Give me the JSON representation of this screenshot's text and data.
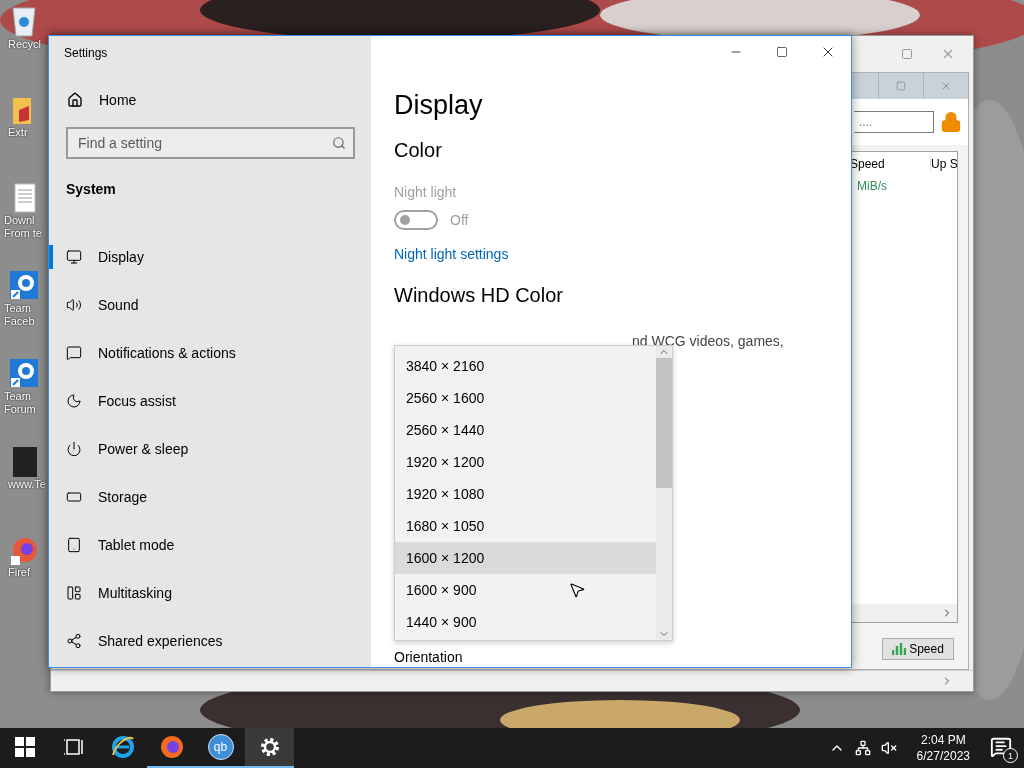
{
  "desktop": {
    "icons": [
      {
        "kind": "recycle",
        "label": "Recycl"
      },
      {
        "kind": "folder",
        "label": "Extr"
      },
      {
        "kind": "document",
        "label": "Downl\nFrom te"
      },
      {
        "kind": "gear",
        "label": "Team\nFaceb"
      },
      {
        "kind": "gear",
        "label": "Team\nForum"
      },
      {
        "kind": "dark",
        "label": "www.Te"
      },
      {
        "kind": "browser",
        "label": "Firef"
      }
    ]
  },
  "background_window": {
    "search": {
      "value": "...."
    },
    "columns": [
      "Speed",
      "Up S"
    ],
    "rows": [
      {
        "column_1": "MiB/s"
      }
    ],
    "speed_button": "Speed"
  },
  "settings": {
    "title": "Settings",
    "sidebar": {
      "home": "Home",
      "search": {
        "placeholder": "Find a setting"
      },
      "section": "System",
      "items": [
        {
          "label": "Display",
          "selected": true
        },
        {
          "label": "Sound",
          "selected": false
        },
        {
          "label": "Notifications & actions",
          "selected": false
        },
        {
          "label": "Focus assist",
          "selected": false
        },
        {
          "label": "Power & sleep",
          "selected": false
        },
        {
          "label": "Storage",
          "selected": false
        },
        {
          "label": "Tablet mode",
          "selected": false
        },
        {
          "label": "Multitasking",
          "selected": false
        },
        {
          "label": "Shared experiences",
          "selected": false
        }
      ]
    },
    "content": {
      "title": "Display",
      "color_heading": "Color",
      "night_light": {
        "label": "Night light",
        "on": false,
        "disabled": true,
        "state_text": "Off"
      },
      "night_light_link": "Night light settings",
      "hd_heading": "Windows HD Color",
      "hd_text": "nd WCG videos, games,",
      "dropdown": {
        "options": [
          {
            "label": "3840 × 2160",
            "highlighted": false
          },
          {
            "label": "2560 × 1600",
            "highlighted": false
          },
          {
            "label": "2560 × 1440",
            "highlighted": false
          },
          {
            "label": "1920 × 1200",
            "highlighted": false
          },
          {
            "label": "1920 × 1080",
            "highlighted": false
          },
          {
            "label": "1680 × 1050",
            "highlighted": false
          },
          {
            "label": "1600 × 1200",
            "highlighted": true
          },
          {
            "label": "1600 × 900",
            "highlighted": false
          },
          {
            "label": "1440 × 900",
            "highlighted": false
          }
        ]
      },
      "orientation_label": "Orientation"
    }
  },
  "taskbar": {
    "apps": [
      {
        "kind": "start",
        "running": false,
        "selected": false
      },
      {
        "kind": "taskview",
        "running": false,
        "selected": false
      },
      {
        "kind": "ie",
        "running": false,
        "selected": false
      },
      {
        "kind": "firefox",
        "running": true,
        "selected": false
      },
      {
        "kind": "qb",
        "text": "qb",
        "running": true,
        "selected": false
      },
      {
        "kind": "settings",
        "running": true,
        "selected": true
      }
    ],
    "clock": {
      "time": "2:04 PM",
      "date": "6/27/2023"
    },
    "notification_count": "1"
  }
}
